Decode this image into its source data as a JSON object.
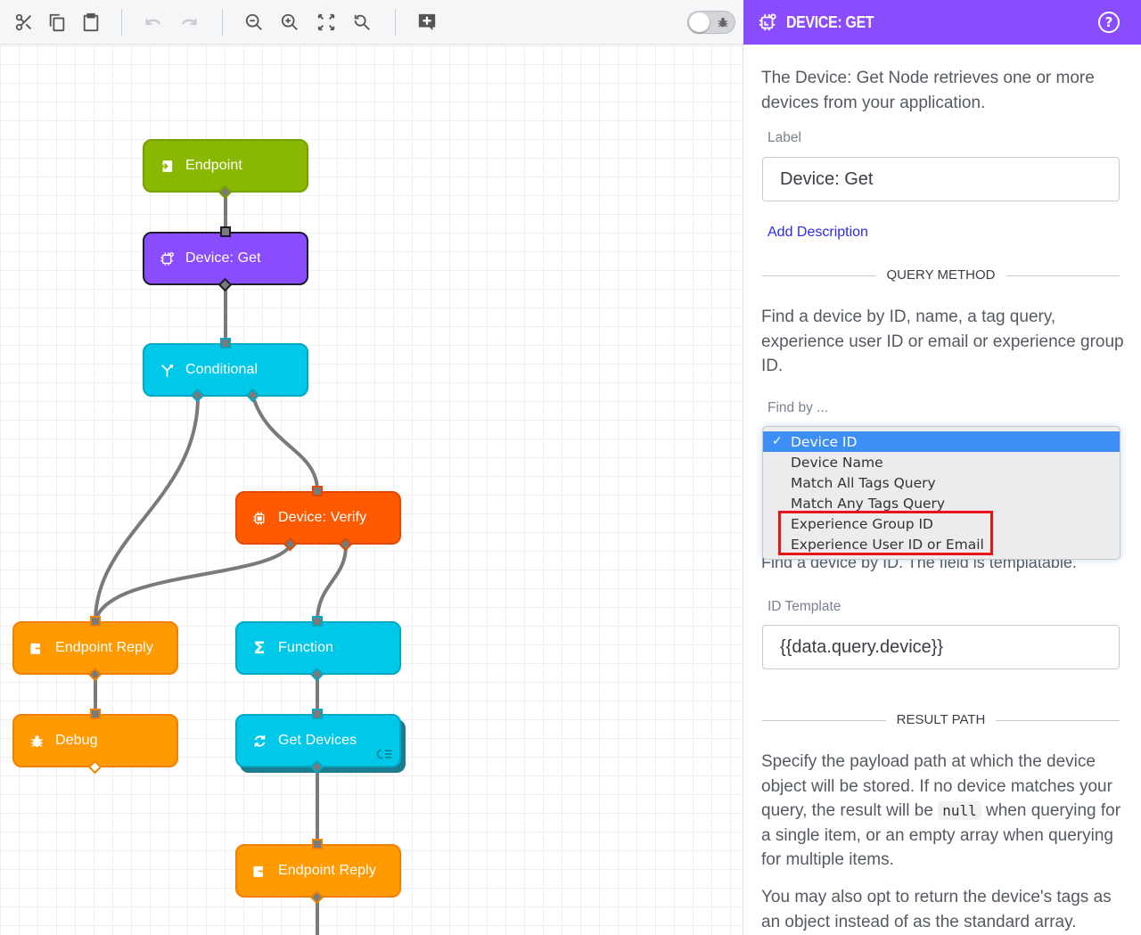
{
  "toolbar": {
    "buttons": [
      {
        "name": "cut",
        "icon": "scissors-icon",
        "enabled": true
      },
      {
        "name": "copy",
        "icon": "copy-icon",
        "enabled": true
      },
      {
        "name": "paste",
        "icon": "clipboard-icon",
        "enabled": true
      },
      {
        "name": "undo",
        "icon": "undo-icon",
        "enabled": false
      },
      {
        "name": "redo",
        "icon": "redo-icon",
        "enabled": false
      },
      {
        "name": "zoom-out",
        "icon": "zoom-out-icon",
        "enabled": true
      },
      {
        "name": "zoom-in",
        "icon": "zoom-in-icon",
        "enabled": true
      },
      {
        "name": "fit-to-screen",
        "icon": "expand-icon",
        "enabled": true
      },
      {
        "name": "reset-zoom",
        "icon": "search-reset-icon",
        "enabled": true
      },
      {
        "name": "add-comment",
        "icon": "add-comment-icon",
        "enabled": true
      }
    ],
    "debug_toggle": {
      "on": false,
      "icon": "bug-icon"
    }
  },
  "canvas": {
    "nodes": [
      {
        "id": "endpoint",
        "label": "Endpoint",
        "color": "#8ab700",
        "icon": "endpoint-icon"
      },
      {
        "id": "device-get",
        "label": "Device: Get",
        "color": "#8a4cff",
        "icon": "device-icon",
        "selected": true
      },
      {
        "id": "conditional",
        "label": "Conditional",
        "color": "#00c8e8",
        "icon": "branch-icon"
      },
      {
        "id": "device-verify",
        "label": "Device: Verify",
        "color": "#ff5a00",
        "icon": "device-verify-icon"
      },
      {
        "id": "endpoint-reply-1",
        "label": "Endpoint Reply",
        "color": "#ff9a00",
        "icon": "endpoint-reply-icon"
      },
      {
        "id": "function",
        "label": "Function",
        "color": "#00c8e8",
        "icon": "sigma-icon"
      },
      {
        "id": "debug",
        "label": "Debug",
        "color": "#ff9a00",
        "icon": "bug-icon"
      },
      {
        "id": "get-devices",
        "label": "Get Devices",
        "color": "#00c8e8",
        "icon": "refresh-icon",
        "loop": true
      },
      {
        "id": "endpoint-reply-2",
        "label": "Endpoint Reply",
        "color": "#ff9a00",
        "icon": "endpoint-reply-icon"
      }
    ]
  },
  "panel": {
    "title": "DEVICE: GET",
    "accent": "#8a4cff",
    "intro": "The Device: Get Node retrieves one or more devices from your application.",
    "label_field": {
      "label": "Label",
      "value": "Device: Get"
    },
    "add_description": "Add Description",
    "query_method_heading": "QUERY METHOD",
    "query_method_text": "Find a device by ID, name, a tag query, experience user ID or email or experience group ID.",
    "find_by": {
      "label": "Find by ...",
      "selected": "Device ID",
      "options": [
        "Device ID",
        "Device Name",
        "Match All Tags Query",
        "Match Any Tags Query",
        "Experience Group ID",
        "Experience User ID or Email"
      ],
      "highlighted_options": [
        "Experience Group ID",
        "Experience User ID or Email"
      ]
    },
    "find_by_hint": "Find a device by ID. The field is templatable.",
    "id_template": {
      "label": "ID Template",
      "value": "{{data.query.device}}"
    },
    "result_path_heading": "RESULT PATH",
    "result_text_1a": "Specify the payload path at which the device object will be stored. If no device matches your query, the result will be",
    "result_text_code": "null",
    "result_text_1b": "when querying for a single item, or an empty array when querying for multiple items.",
    "result_text_2": "You may also opt to return the device's tags as an object instead of as the standard array."
  }
}
